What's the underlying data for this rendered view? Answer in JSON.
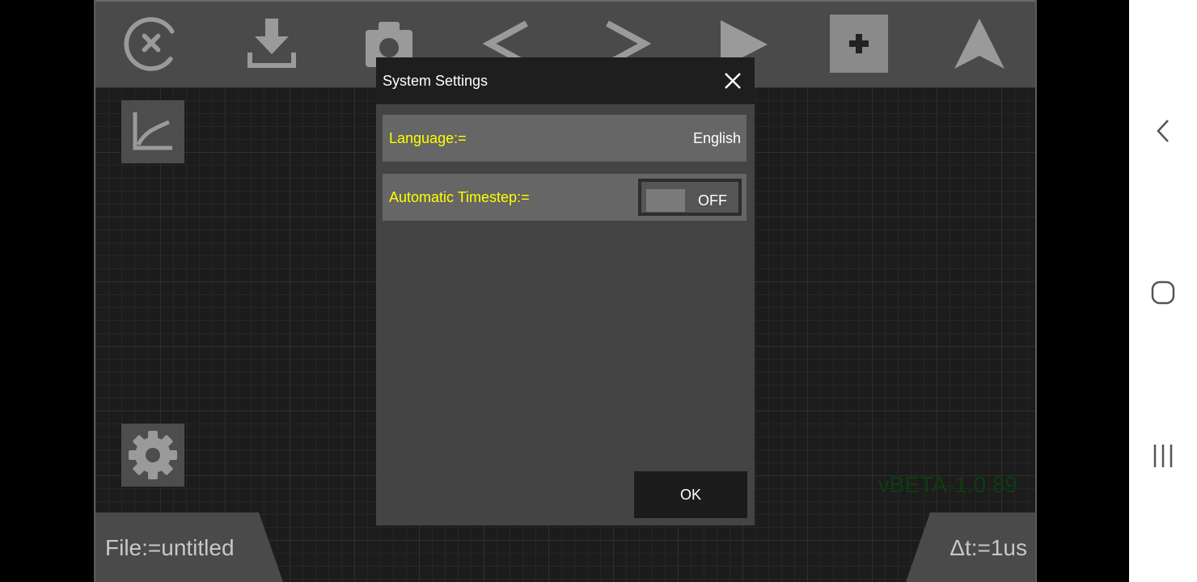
{
  "toolbar": {
    "icons": [
      "close-circle-icon",
      "download-icon",
      "camera-icon",
      "chevron-left-icon",
      "chevron-right-icon",
      "play-icon",
      "plus-icon",
      "navigation-arrow-icon"
    ]
  },
  "sidebar": {
    "graph_icon": "graph-icon",
    "settings_icon": "gear-icon"
  },
  "status": {
    "file_label": "File:=untitled",
    "timestep_label": "Δt:=1us",
    "version": "vBETA-1.0.89"
  },
  "dialog": {
    "title": "System Settings",
    "language_label": "Language:=",
    "language_value": "English",
    "auto_timestep_label": "Automatic Timestep:=",
    "auto_timestep_state": "OFF",
    "ok_label": "OK"
  },
  "colors": {
    "label_yellow": "#ffff00",
    "version_green": "#0c3d10",
    "toolbar_gray": "#4a4a4a"
  },
  "system_nav": {
    "icons": [
      "back-icon",
      "home-icon",
      "recents-icon"
    ]
  }
}
